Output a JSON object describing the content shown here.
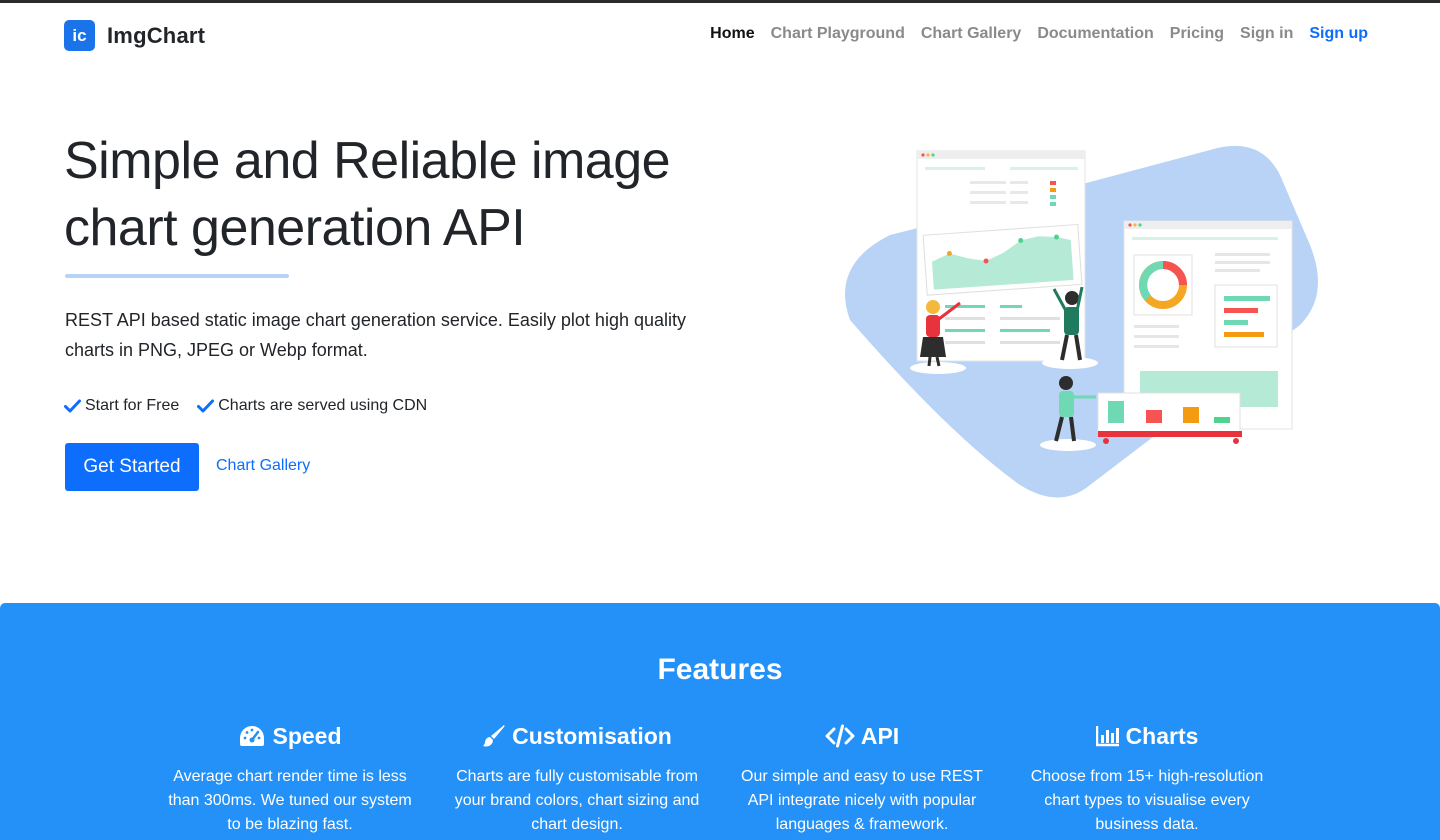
{
  "brand": {
    "logo_text": "ic",
    "name": "ImgChart",
    "accent": "#1a73e8"
  },
  "nav": {
    "items": [
      {
        "label": "Home"
      },
      {
        "label": "Chart Playground"
      },
      {
        "label": "Chart Gallery"
      },
      {
        "label": "Documentation"
      },
      {
        "label": "Pricing"
      },
      {
        "label": "Sign in"
      },
      {
        "label": "Sign up"
      }
    ]
  },
  "hero": {
    "title_line1": "Simple and Reliable image",
    "title_line2": "chart generation API",
    "description": "REST API based static image chart generation service. Easily plot high quality charts in PNG, JPEG or Webp format.",
    "checks": [
      {
        "label": "Start for Free",
        "icon": "check-icon"
      },
      {
        "label": "Charts are served using CDN",
        "icon": "check-icon"
      }
    ],
    "primary_button": "Get Started",
    "secondary_link": "Chart Gallery"
  },
  "features": {
    "title": "Features",
    "background": "#2391f8",
    "items": [
      {
        "title": "Speed",
        "icon": "speedometer-icon",
        "text": "Average chart render time is less than 300ms. We tuned our system to be blazing fast."
      },
      {
        "title": "Customisation",
        "icon": "paintbrush-icon",
        "text": "Charts are fully customisable from your brand colors, chart sizing and chart design."
      },
      {
        "title": "API",
        "icon": "code-icon",
        "text": "Our simple and easy to use REST API integrate nicely with popular languages & framework."
      },
      {
        "title": "Charts",
        "icon": "bar-chart-icon",
        "text": "Choose from 15+ high-resolution chart types to visualise every business data."
      }
    ]
  }
}
